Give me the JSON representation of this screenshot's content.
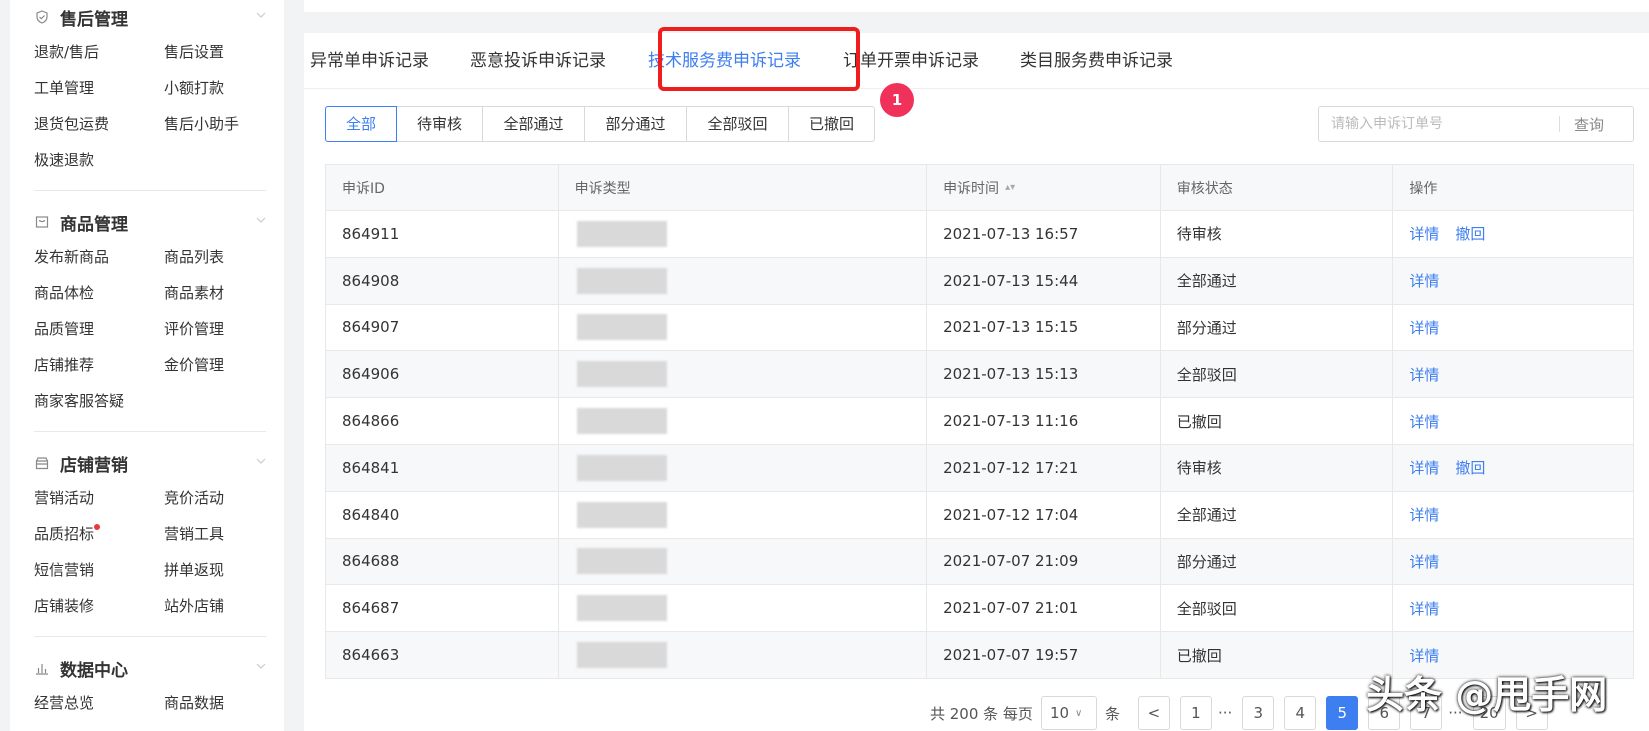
{
  "sidebar": {
    "sections": [
      {
        "title": "售后管理",
        "icon": "shield-check-icon",
        "items": [
          "退款/售后",
          "售后设置",
          "工单管理",
          "小额打款",
          "退货包运费",
          "售后小助手",
          "极速退款"
        ]
      },
      {
        "title": "商品管理",
        "icon": "bag-icon",
        "items": [
          "发布新商品",
          "商品列表",
          "商品体检",
          "商品素材",
          "品质管理",
          "评价管理",
          "店铺推荐",
          "金价管理",
          "商家客服答疑"
        ]
      },
      {
        "title": "店铺营销",
        "icon": "store-icon",
        "items": [
          "营销活动",
          "竞价活动",
          "品质招标",
          "营销工具",
          "短信营销",
          "拼单返现",
          "店铺装修",
          "站外店铺"
        ]
      },
      {
        "title": "数据中心",
        "icon": "bar-chart-icon",
        "items": [
          "经营总览",
          "商品数据"
        ]
      }
    ]
  },
  "tabs": [
    "异常单申诉记录",
    "恶意投诉申诉记录",
    "技术服务费申诉记录",
    "订单开票申诉记录",
    "类目服务费申诉记录"
  ],
  "active_tab": "技术服务费申诉记录",
  "badge": "1",
  "filters": [
    "全部",
    "待审核",
    "全部通过",
    "部分通过",
    "全部驳回",
    "已撤回"
  ],
  "search": {
    "placeholder": "请输入申诉订单号",
    "button": "查询"
  },
  "table": {
    "headers": [
      "申诉ID",
      "申诉类型",
      "申诉时间",
      "审核状态",
      "操作"
    ],
    "rows": [
      {
        "id": "864911",
        "time": "2021-07-13 16:57",
        "status": "待审核",
        "actions": [
          "详情",
          "撤回"
        ]
      },
      {
        "id": "864908",
        "time": "2021-07-13 15:44",
        "status": "全部通过",
        "actions": [
          "详情"
        ]
      },
      {
        "id": "864907",
        "time": "2021-07-13 15:15",
        "status": "部分通过",
        "actions": [
          "详情"
        ]
      },
      {
        "id": "864906",
        "time": "2021-07-13 15:13",
        "status": "全部驳回",
        "actions": [
          "详情"
        ]
      },
      {
        "id": "864866",
        "time": "2021-07-13 11:16",
        "status": "已撤回",
        "actions": [
          "详情"
        ]
      },
      {
        "id": "864841",
        "time": "2021-07-12 17:21",
        "status": "待审核",
        "actions": [
          "详情",
          "撤回"
        ]
      },
      {
        "id": "864840",
        "time": "2021-07-12 17:04",
        "status": "全部通过",
        "actions": [
          "详情"
        ]
      },
      {
        "id": "864688",
        "time": "2021-07-07 21:09",
        "status": "部分通过",
        "actions": [
          "详情"
        ]
      },
      {
        "id": "864687",
        "time": "2021-07-07 21:01",
        "status": "全部驳回",
        "actions": [
          "详情"
        ]
      },
      {
        "id": "864663",
        "time": "2021-07-07 19:57",
        "status": "已撤回",
        "actions": [
          "详情"
        ]
      }
    ]
  },
  "pager": {
    "total_text": "共 200 条 每页",
    "page_size": "10",
    "unit": "条",
    "prev": "<",
    "next": ">",
    "pages": [
      "1",
      "···",
      "3",
      "4",
      "5",
      "6",
      "7",
      "···",
      "20"
    ],
    "current": "5"
  },
  "watermark": "头条 @甩手网",
  "colors": {
    "accent": "#3d7ef0",
    "highlight": "#f01d1d",
    "badge": "#f0315a"
  }
}
